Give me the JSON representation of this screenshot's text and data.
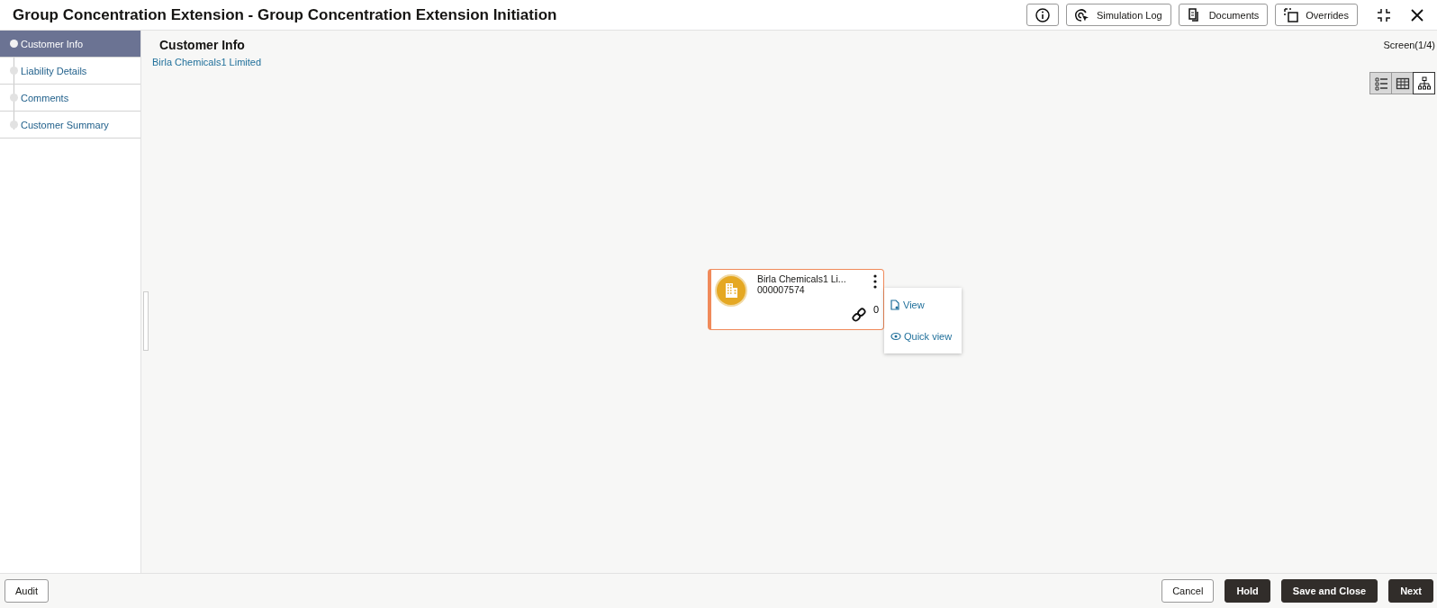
{
  "window": {
    "title": "Group Concentration Extension - Group Concentration Extension Initiation"
  },
  "header_buttons": [
    {
      "kind": "info"
    },
    {
      "kind": "log",
      "label": "Simulation Log"
    },
    {
      "kind": "docs",
      "label": "Documents"
    },
    {
      "kind": "overrides",
      "label": "Overrides"
    }
  ],
  "steps": [
    {
      "label": "Customer Info",
      "selected": true
    },
    {
      "label": "Liability Details",
      "selected": false
    },
    {
      "label": "Comments",
      "selected": false
    },
    {
      "label": "Customer Summary",
      "selected": false
    }
  ],
  "content": {
    "title": "Customer Info",
    "screen": "Screen(1/4)",
    "breadcrumb": "Birla Chemicals1 Limited"
  },
  "view_modes": [
    {
      "kind": "list",
      "selected": false
    },
    {
      "kind": "table",
      "selected": false
    },
    {
      "kind": "tree",
      "selected": true
    }
  ],
  "node": {
    "name": "Birla Chemicals1 Li...",
    "id": "000007574",
    "links": "0"
  },
  "node_menu": [
    {
      "kind": "view",
      "label": "View"
    },
    {
      "kind": "quick",
      "label": "Quick view"
    }
  ],
  "footer": {
    "left": [
      "Audit"
    ],
    "right": [
      {
        "label": "Cancel",
        "kind": "secondary"
      },
      {
        "label": "Hold",
        "kind": "primary"
      },
      {
        "label": "Save and Close",
        "kind": "primary"
      },
      {
        "label": "Next",
        "kind": "primary"
      }
    ]
  }
}
